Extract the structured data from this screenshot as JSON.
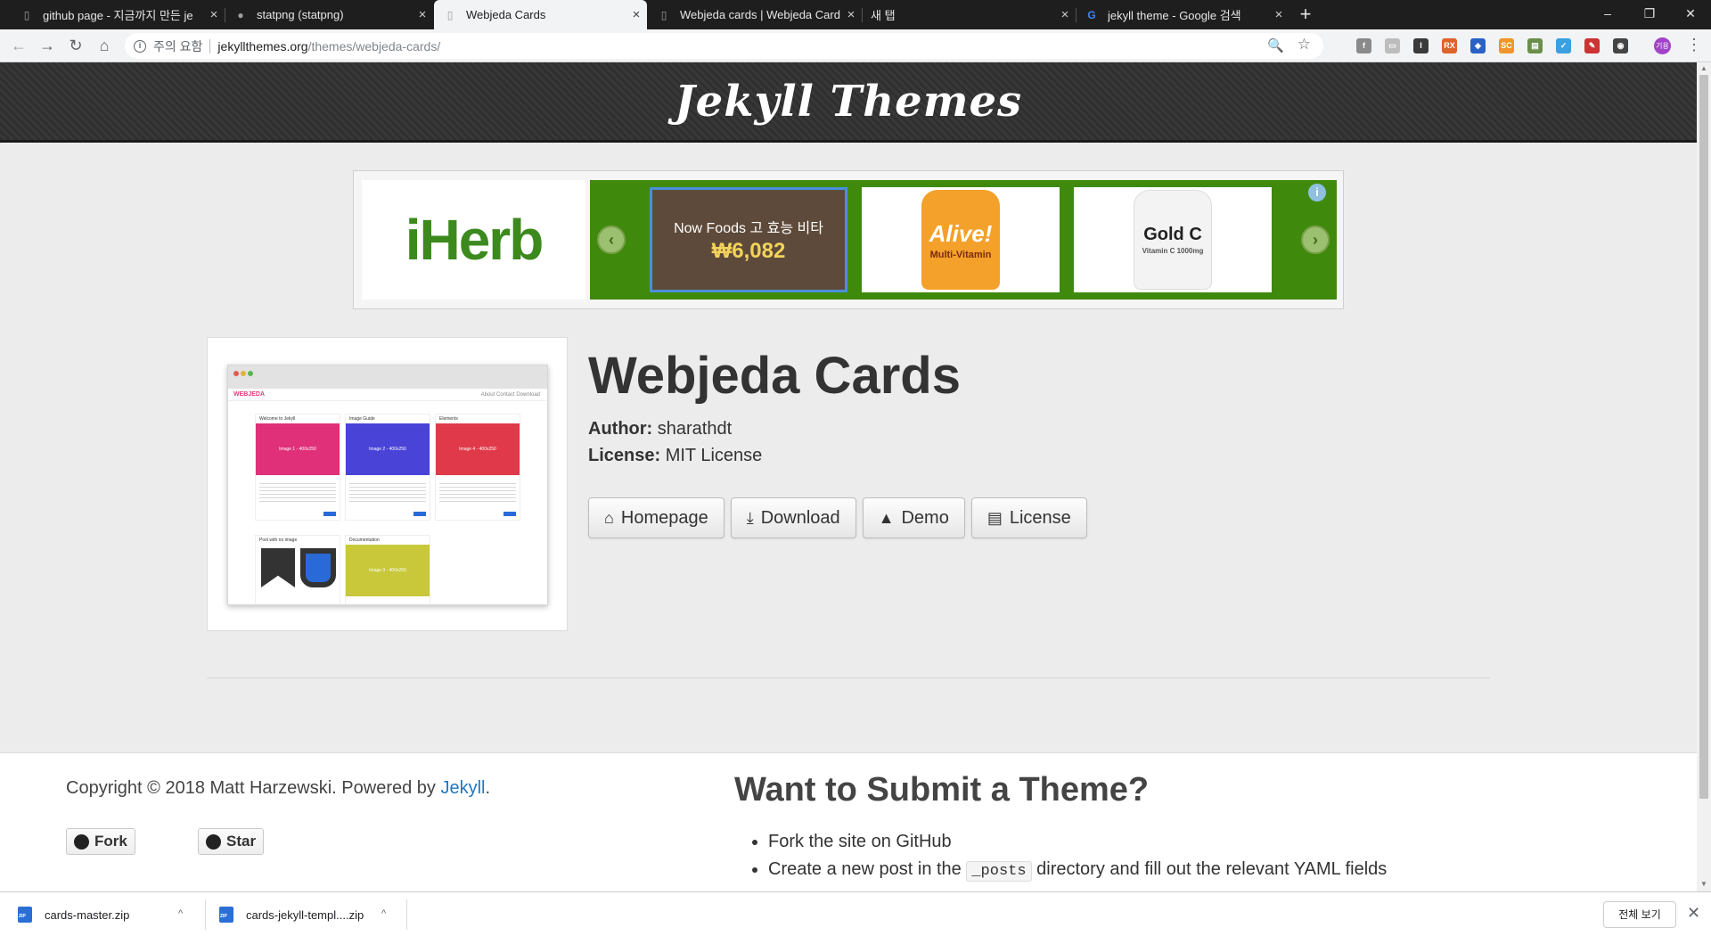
{
  "browser": {
    "tabs": [
      {
        "title": "github page - 지금까지 만든 je",
        "close": "×"
      },
      {
        "title": "statpng (statpng)",
        "close": "×"
      },
      {
        "title": "Webjeda Cards",
        "close": "×"
      },
      {
        "title": "Webjeda cards | Webjeda Cards",
        "close": "×"
      },
      {
        "title": "새 탭",
        "close": "×"
      },
      {
        "title": "jekyll theme - Google 검색",
        "close": "×"
      }
    ],
    "new_tab": "+",
    "window_controls": {
      "minimize": "–",
      "restore": "❐",
      "close": "✕"
    },
    "nav": {
      "back": "←",
      "forward": "→",
      "reload": "↻",
      "home": "⌂"
    },
    "address": {
      "info": "i",
      "warning": "주의 요함",
      "host": "jekyllthemes.org",
      "path": "/themes/webjeda-cards/",
      "zoom": "🔍",
      "star": "☆"
    },
    "extensions": [
      {
        "name": "ext-1-icon",
        "label": "f",
        "color": "#8a8a8a"
      },
      {
        "name": "ext-2-icon",
        "label": "▭",
        "color": "#bdbdbd"
      },
      {
        "name": "ext-3-icon",
        "label": "I",
        "color": "#3a3a3a"
      },
      {
        "name": "ext-4-icon",
        "label": "RX",
        "color": "#e0622b"
      },
      {
        "name": "ext-5-icon",
        "label": "◆",
        "color": "#2a62c8"
      },
      {
        "name": "ext-6-icon",
        "label": "SC",
        "color": "#f0952a"
      },
      {
        "name": "ext-7-icon",
        "label": "▤",
        "color": "#6a8f4b"
      },
      {
        "name": "ext-8-icon",
        "label": "✓",
        "color": "#3aa0e0"
      },
      {
        "name": "ext-9-icon",
        "label": "✎",
        "color": "#c33"
      },
      {
        "name": "ext-10-icon",
        "label": "◉",
        "color": "#444"
      }
    ],
    "profile": "기용",
    "menu": "⋮"
  },
  "site": {
    "logo": "Jekyll Themes"
  },
  "ad": {
    "brand": "iHerb",
    "product": "Now Foods 고 효능 비타",
    "price": "₩6,082",
    "bottle2": {
      "line1": "Alive!",
      "line2": "Multi-Vitamin"
    },
    "bottle3": {
      "line1": "Gold C",
      "line2": "Vitamin C 1000mg"
    },
    "prev": "‹",
    "next": "›",
    "info": "i"
  },
  "preview": {
    "brand": "WEBJEDA",
    "nav": "About   Contact   Download",
    "cards": [
      {
        "title": "Welcome to Jekyll",
        "image": "Image 1 - 400x250",
        "color": "#e0307a"
      },
      {
        "title": "Image Guide",
        "image": "Image 2 - 400x250",
        "color": "#4a43d8"
      },
      {
        "title": "Elements",
        "image": "Image 4 - 400x250",
        "color": "#e03a4a"
      },
      {
        "title": "Post with no image",
        "image": "",
        "color": "#ffffff"
      },
      {
        "title": "Documentation",
        "image": "Image 3 - 400x250",
        "color": "#c8c83a"
      }
    ]
  },
  "theme": {
    "title": "Webjeda Cards",
    "author_label": "Author:",
    "author": "sharathdt",
    "license_label": "License:",
    "license": "MIT License",
    "buttons": [
      {
        "icon": "home-icon",
        "glyph": "⌂",
        "label": "Homepage"
      },
      {
        "icon": "download-icon",
        "glyph": "⤓",
        "label": "Download"
      },
      {
        "icon": "flask-icon",
        "glyph": "▲",
        "label": "Demo"
      },
      {
        "icon": "file-icon",
        "glyph": "▤",
        "label": "License"
      }
    ]
  },
  "footer": {
    "copyright": "Copyright © 2018 Matt Harzewski. Powered by",
    "powered_link": "Jekyll",
    "period": ".",
    "fork": "Fork",
    "star": "Star",
    "submit_title": "Want to Submit a Theme?",
    "steps": [
      {
        "text": "Fork the site on GitHub"
      },
      {
        "pre": "Create a new post in the",
        "code": "_posts",
        "post": "directory and fill out the relevant YAML fields"
      }
    ]
  },
  "downloads": {
    "items": [
      "cards-master.zip",
      "cards-jekyll-templ....zip"
    ],
    "chevron": "^",
    "show_all": "전체 보기",
    "close": "✕"
  }
}
